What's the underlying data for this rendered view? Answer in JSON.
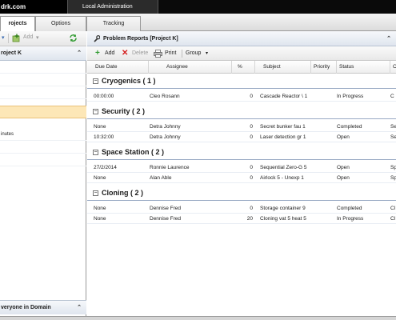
{
  "top": {
    "brand": "drk.com",
    "admin_tab": "Local Administration"
  },
  "tabs": [
    {
      "label": "rojects"
    },
    {
      "label": "Options"
    },
    {
      "label": "Tracking"
    }
  ],
  "left": {
    "toolbar": {
      "add_label": "Add"
    },
    "header": "roject K",
    "items": [
      {
        "label": ""
      },
      {
        "label": ""
      },
      {
        "label": ""
      },
      {
        "label": ""
      },
      {
        "label": "inutes"
      },
      {
        "label": ""
      },
      {
        "label": ""
      }
    ],
    "footer": "veryone in Domain"
  },
  "main": {
    "title": "Problem Reports [Project K]",
    "toolbar": {
      "add": "Add",
      "delete": "Delete",
      "print": "Print",
      "group": "Group"
    },
    "columns": [
      "Due Date",
      "Assignee",
      "%",
      "Subject",
      "Priority",
      "Status",
      "C"
    ],
    "groups": [
      {
        "name": "Cryogenics ( 1 )",
        "rows": [
          {
            "due": "00:00:00",
            "assignee": "Cleo Rosann",
            "pct": "0",
            "subject": "Cascade Reactor \\ 1",
            "priority": "",
            "status": "In Progress",
            "c": "C"
          }
        ]
      },
      {
        "name": "Security ( 2 )",
        "rows": [
          {
            "due": "None",
            "assignee": "Detra Johnny",
            "pct": "0",
            "subject": "Secret bunker fau 1",
            "priority": "",
            "status": "Completed",
            "c": "Se"
          },
          {
            "due": "10:32:00",
            "assignee": "Detra Johnny",
            "pct": "0",
            "subject": "Laser detection gr 1",
            "priority": "",
            "status": "Open",
            "c": "Se"
          }
        ]
      },
      {
        "name": "Space Station ( 2 )",
        "rows": [
          {
            "due": "27/2/2014",
            "assignee": "Ronnie Laurence",
            "pct": "0",
            "subject": "Sequential Zero-G 5",
            "priority": "",
            "status": "Open",
            "c": "Sp"
          },
          {
            "due": "None",
            "assignee": "Alan Able",
            "pct": "0",
            "subject": "Airlock 5 - Unexp 1",
            "priority": "",
            "status": "Open",
            "c": "Sp"
          }
        ]
      },
      {
        "name": "Cloning ( 2 )",
        "rows": [
          {
            "due": "None",
            "assignee": "Dennise Fred",
            "pct": "0",
            "subject": "Storage container 9",
            "priority": "",
            "status": "Completed",
            "c": "Cl"
          },
          {
            "due": "None",
            "assignee": "Dennise Fred",
            "pct": "20",
            "subject": "Cloning vat 5 heat 5",
            "priority": "",
            "status": "In Progress",
            "c": "Cl"
          }
        ]
      }
    ]
  },
  "colors": {
    "topbar": "#0a0a0a",
    "panel_header": "#dfe5ee",
    "selected_row": "#fde7b7",
    "add_green": "#2e9a2e",
    "delete_red": "#d42020"
  }
}
